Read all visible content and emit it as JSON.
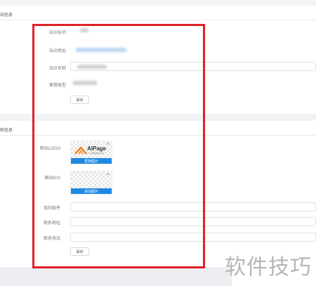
{
  "basic_section": {
    "title": "站信息",
    "fields": [
      {
        "label": "站点标识"
      },
      {
        "label": "站点地址"
      },
      {
        "label": "站点名称"
      },
      {
        "label": "套餐类型"
      }
    ],
    "save_label": "保存"
  },
  "extra_section": {
    "title": "助信息",
    "logo": {
      "label": "网站LOGO",
      "brand_text": "AIPage",
      "brand_sub": "人工智能建站平台",
      "action_label": "更换图片",
      "close_glyph": "×"
    },
    "ico": {
      "label": "网站ICO",
      "action_label": "添加图片",
      "close_glyph": "×"
    },
    "contact_fields": [
      {
        "label": "我的邮件",
        "value": ""
      },
      {
        "label": "联系地址",
        "value": ""
      },
      {
        "label": "联系电话",
        "value": ""
      }
    ],
    "save_label": "保存"
  },
  "watermark": "软件技巧",
  "colors": {
    "accent": "#1e88e5",
    "highlight_border": "#e0202a",
    "logo_orange": "#f0811d"
  }
}
